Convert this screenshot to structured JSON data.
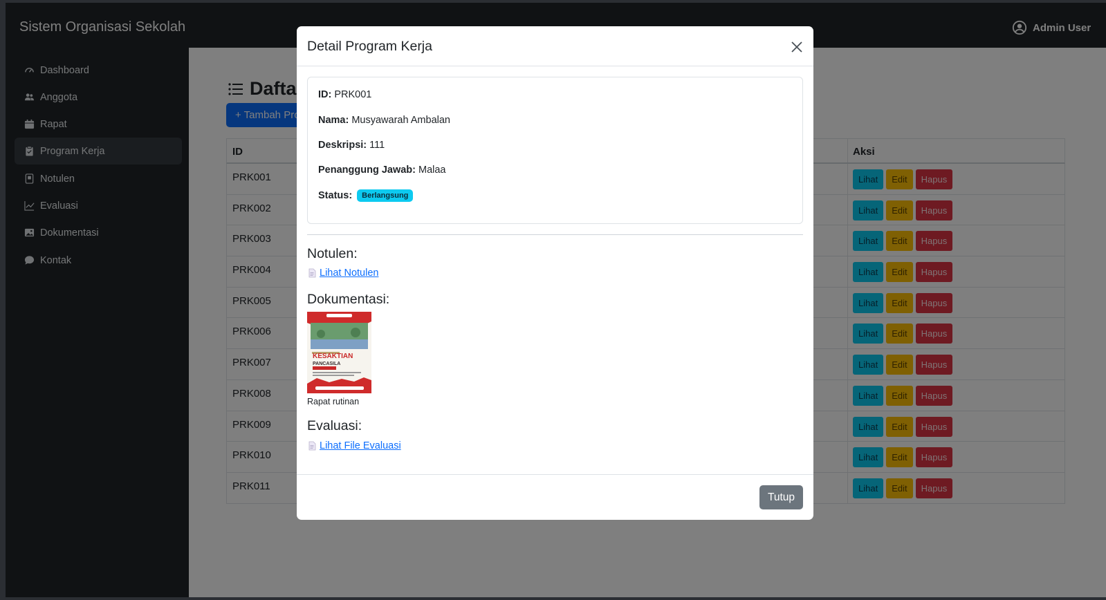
{
  "header": {
    "brand": "Sistem Organisasi Sekolah",
    "user": "Admin User"
  },
  "sidebar": {
    "items": [
      {
        "label": "Dashboard",
        "icon": "speedometer-icon"
      },
      {
        "label": "Anggota",
        "icon": "people-icon"
      },
      {
        "label": "Rapat",
        "icon": "calendar-icon"
      },
      {
        "label": "Program Kerja",
        "icon": "clipboard-icon",
        "active": true
      },
      {
        "label": "Notulen",
        "icon": "journal-icon"
      },
      {
        "label": "Evaluasi",
        "icon": "graph-up-icon"
      },
      {
        "label": "Dokumentasi",
        "icon": "image-icon"
      },
      {
        "label": "Kontak",
        "icon": "chat-icon"
      }
    ]
  },
  "page": {
    "title": "Daftar Program Kerja",
    "add_button": "+ Tambah Program Kerja",
    "table": {
      "headers": {
        "id": "ID",
        "aksi": "Aksi"
      },
      "rows": [
        "PRK001",
        "PRK002",
        "PRK003",
        "PRK004",
        "PRK005",
        "PRK006",
        "PRK007",
        "PRK008",
        "PRK009",
        "PRK010",
        "PRK011"
      ],
      "actions": {
        "view": "Lihat",
        "edit": "Edit",
        "delete": "Hapus"
      }
    }
  },
  "modal": {
    "title": "Detail Program Kerja",
    "fields": {
      "id_label": "ID:",
      "id_value": "PRK001",
      "nama_label": "Nama:",
      "nama_value": "Musyawarah Ambalan",
      "deskripsi_label": "Deskripsi:",
      "deskripsi_value": "111",
      "pj_label": "Penanggung Jawab:",
      "pj_value": "Malaa",
      "status_label": "Status:",
      "status_value": "Berlangsung"
    },
    "notulen": {
      "heading": "Notulen:",
      "link": "Lihat Notulen"
    },
    "dokumentasi": {
      "heading": "Dokumentasi:",
      "caption": "Rapat rutinan",
      "poster": {
        "line1": "KESAKTIAN",
        "line2": "PANCASILA"
      }
    },
    "evaluasi": {
      "heading": "Evaluasi:",
      "link": "Lihat File Evaluasi"
    },
    "close_button": "Tutup"
  },
  "colors": {
    "primary": "#0d6efd",
    "info": "#0dcaf0",
    "warning": "#ffc107",
    "danger": "#dc3545",
    "secondary": "#6c757d",
    "dark": "#212529"
  }
}
